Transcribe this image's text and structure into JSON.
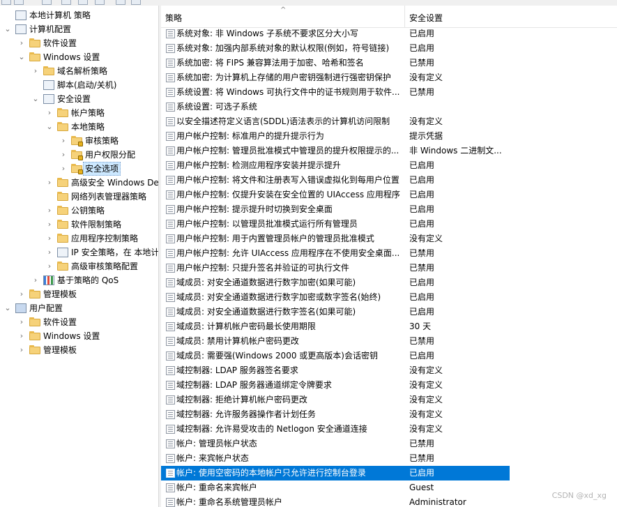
{
  "colors": {
    "selection": "#0078d7",
    "tree_selection": "#cce8ff",
    "folder": "#f6d27a"
  },
  "tree": [
    {
      "label": "本地计算机 策略",
      "icon": "policy-doc-icon",
      "expander": "",
      "level": 0
    },
    {
      "label": "计算机配置",
      "icon": "computer-icon",
      "expander": "open",
      "level": 0
    },
    {
      "label": "软件设置",
      "icon": "folder-icon",
      "expander": "closed",
      "level": 1
    },
    {
      "label": "Windows 设置",
      "icon": "folder-icon",
      "expander": "open",
      "level": 1
    },
    {
      "label": "域名解析策略",
      "icon": "folder-icon",
      "expander": "closed",
      "level": 2
    },
    {
      "label": "脚本(启动/关机)",
      "icon": "script-icon",
      "expander": "",
      "level": 2
    },
    {
      "label": "安全设置",
      "icon": "security-settings-icon",
      "expander": "open",
      "level": 2
    },
    {
      "label": "帐户策略",
      "icon": "folder-icon",
      "expander": "closed",
      "level": 3
    },
    {
      "label": "本地策略",
      "icon": "folder-icon",
      "expander": "open",
      "level": 3
    },
    {
      "label": "审核策略",
      "icon": "secure-folder-icon",
      "expander": "closed",
      "level": 4
    },
    {
      "label": "用户权限分配",
      "icon": "secure-folder-icon",
      "expander": "closed",
      "level": 4
    },
    {
      "label": "安全选项",
      "icon": "secure-folder-icon",
      "expander": "closed",
      "level": 4,
      "selected": true
    },
    {
      "label": "高级安全 Windows De",
      "icon": "folder-icon",
      "expander": "closed",
      "level": 3
    },
    {
      "label": "网络列表管理器策略",
      "icon": "folder-icon",
      "expander": "",
      "level": 3
    },
    {
      "label": "公钥策略",
      "icon": "folder-icon",
      "expander": "closed",
      "level": 3
    },
    {
      "label": "软件限制策略",
      "icon": "folder-icon",
      "expander": "closed",
      "level": 3
    },
    {
      "label": "应用程序控制策略",
      "icon": "folder-icon",
      "expander": "closed",
      "level": 3
    },
    {
      "label": "IP 安全策略，在 本地计",
      "icon": "ipsec-icon",
      "expander": "closed",
      "level": 3
    },
    {
      "label": "高级审核策略配置",
      "icon": "folder-icon",
      "expander": "closed",
      "level": 3
    },
    {
      "label": "基于策略的 QoS",
      "icon": "qos-chart-icon",
      "expander": "closed",
      "level": 2
    },
    {
      "label": "管理模板",
      "icon": "folder-icon",
      "expander": "closed",
      "level": 1
    },
    {
      "label": "用户配置",
      "icon": "user-icon",
      "expander": "open",
      "level": 0
    },
    {
      "label": "软件设置",
      "icon": "folder-icon",
      "expander": "closed",
      "level": 1
    },
    {
      "label": "Windows 设置",
      "icon": "folder-icon",
      "expander": "closed",
      "level": 1
    },
    {
      "label": "管理模板",
      "icon": "folder-icon",
      "expander": "closed",
      "level": 1
    }
  ],
  "list": {
    "columns": {
      "policy": "策略",
      "setting": "安全设置"
    },
    "sort_indicator": "^",
    "rows": [
      {
        "policy": "系统对象: 非 Windows 子系统不要求区分大小写",
        "setting": "已启用"
      },
      {
        "policy": "系统对象: 加强内部系统对象的默认权限(例如，符号链接)",
        "setting": "已启用"
      },
      {
        "policy": "系统加密: 将 FIPS 兼容算法用于加密、哈希和签名",
        "setting": "已禁用"
      },
      {
        "policy": "系统加密: 为计算机上存储的用户密钥强制进行强密钥保护",
        "setting": "没有定义"
      },
      {
        "policy": "系统设置: 将 Windows 可执行文件中的证书规则用于软件...",
        "setting": "已禁用"
      },
      {
        "policy": "系统设置: 可选子系统",
        "setting": ""
      },
      {
        "policy": "以安全描述符定义语言(SDDL)语法表示的计算机访问限制",
        "setting": "没有定义"
      },
      {
        "policy": "用户帐户控制: 标准用户的提升提示行为",
        "setting": "提示凭据"
      },
      {
        "policy": "用户帐户控制: 管理员批准模式中管理员的提升权限提示的...",
        "setting": "非 Windows 二进制文..."
      },
      {
        "policy": "用户帐户控制: 检测应用程序安装并提示提升",
        "setting": "已启用"
      },
      {
        "policy": "用户帐户控制: 将文件和注册表写入错误虚拟化到每用户位置",
        "setting": "已启用"
      },
      {
        "policy": "用户帐户控制: 仅提升安装在安全位置的 UIAccess 应用程序",
        "setting": "已启用"
      },
      {
        "policy": "用户帐户控制: 提示提升时切换到安全桌面",
        "setting": "已启用"
      },
      {
        "policy": "用户帐户控制: 以管理员批准模式运行所有管理员",
        "setting": "已启用"
      },
      {
        "policy": "用户帐户控制: 用于内置管理员帐户的管理员批准模式",
        "setting": "没有定义"
      },
      {
        "policy": "用户帐户控制: 允许 UIAccess 应用程序在不使用安全桌面...",
        "setting": "已禁用"
      },
      {
        "policy": "用户帐户控制: 只提升签名并验证的可执行文件",
        "setting": "已禁用"
      },
      {
        "policy": "域成员: 对安全通道数据进行数字加密(如果可能)",
        "setting": "已启用"
      },
      {
        "policy": "域成员: 对安全通道数据进行数字加密或数字签名(始终)",
        "setting": "已启用"
      },
      {
        "policy": "域成员: 对安全通道数据进行数字签名(如果可能)",
        "setting": "已启用"
      },
      {
        "policy": "域成员: 计算机帐户密码最长使用期限",
        "setting": "30 天"
      },
      {
        "policy": "域成员: 禁用计算机帐户密码更改",
        "setting": "已禁用"
      },
      {
        "policy": "域成员: 需要强(Windows 2000 或更高版本)会话密钥",
        "setting": "已启用"
      },
      {
        "policy": "域控制器: LDAP 服务器签名要求",
        "setting": "没有定义"
      },
      {
        "policy": "域控制器: LDAP 服务器通道绑定令牌要求",
        "setting": "没有定义"
      },
      {
        "policy": "域控制器: 拒绝计算机帐户密码更改",
        "setting": "没有定义"
      },
      {
        "policy": "域控制器: 允许服务器操作者计划任务",
        "setting": "没有定义"
      },
      {
        "policy": "域控制器: 允许易受攻击的 Netlogon 安全通道连接",
        "setting": "没有定义"
      },
      {
        "policy": "帐户: 管理员帐户状态",
        "setting": "已禁用"
      },
      {
        "policy": "帐户: 来宾帐户状态",
        "setting": "已禁用"
      },
      {
        "policy": "帐户: 使用空密码的本地帐户只允许进行控制台登录",
        "setting": "已启用",
        "selected": true
      },
      {
        "policy": "帐户: 重命名来宾帐户",
        "setting": "Guest"
      },
      {
        "policy": "帐户: 重命名系统管理员帐户",
        "setting": "Administrator"
      }
    ]
  },
  "watermark": "CSDN @xd_xg"
}
